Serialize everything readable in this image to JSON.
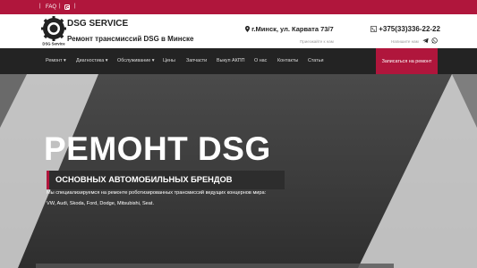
{
  "topbar": {
    "faq_label": "FAQ",
    "separator": "|"
  },
  "header": {
    "logo_text": "DSG Service",
    "title": "DSG SERVICE",
    "subtitle": "Ремонт трансмиссий DSG в Минске",
    "address": "г.Минск, ул. Карвата 73/7",
    "address_note": "Приезжайте к нам",
    "phone": "+375(33)336-22-22",
    "phone_note": "Напишите нам"
  },
  "nav": {
    "items": [
      {
        "label": "Ремонт ▾"
      },
      {
        "label": "Диагностика ▾"
      },
      {
        "label": "Обслуживание ▾"
      },
      {
        "label": "Цены"
      },
      {
        "label": "Запчасти"
      },
      {
        "label": "Выкуп АКПП"
      },
      {
        "label": "О нас"
      },
      {
        "label": "Контакты"
      },
      {
        "label": "Статьи"
      }
    ],
    "cta_label": "Записаться на ремонт"
  },
  "hero": {
    "title": "РЕМОНТ DSG",
    "subtitle": "ОСНОВНЫХ АВТОМОБИЛЬНЫХ БРЕНДОВ",
    "description": "Мы специализируемся на ремонте роботизированных трансмиссий ведущих концернов мира:",
    "brands": "VW, Audi, Skoda, Ford, Dodge, Mitsubishi, Seat."
  },
  "colors": {
    "accent": "#b0163c",
    "nav_bg": "#232323"
  },
  "icons": [
    "instagram-icon",
    "map-pin-icon",
    "phone-icon",
    "telegram-icon",
    "whatsapp-icon",
    "gear-logo-icon"
  ]
}
